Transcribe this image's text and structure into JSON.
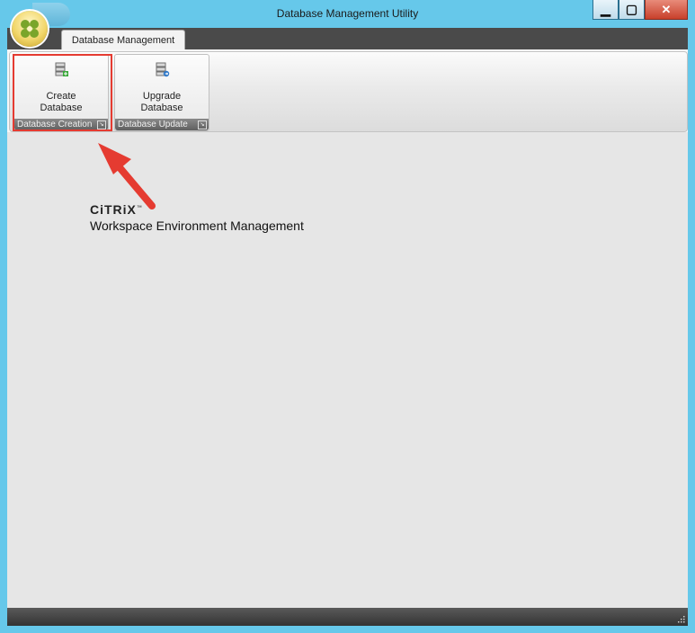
{
  "window": {
    "title": "Database Management Utility"
  },
  "tabs": [
    {
      "label": "Database Management",
      "active": true
    }
  ],
  "ribbon": {
    "groups": [
      {
        "caption": "Database Creation",
        "button": {
          "line1": "Create",
          "line2": "Database",
          "icon": "database-add-icon"
        }
      },
      {
        "caption": "Database Update",
        "button": {
          "line1": "Upgrade",
          "line2": "Database",
          "icon": "database-upgrade-icon"
        }
      }
    ]
  },
  "branding": {
    "company": "CiTRiX",
    "trademark": "™",
    "product": "Workspace Environment Management"
  },
  "colors": {
    "titlebar": "#66c8ea",
    "annotation": "#e53b31",
    "close": "#c8402b",
    "workspace": "#e6e6e6"
  },
  "annotation": {
    "type": "arrow",
    "target": "Create Database"
  }
}
